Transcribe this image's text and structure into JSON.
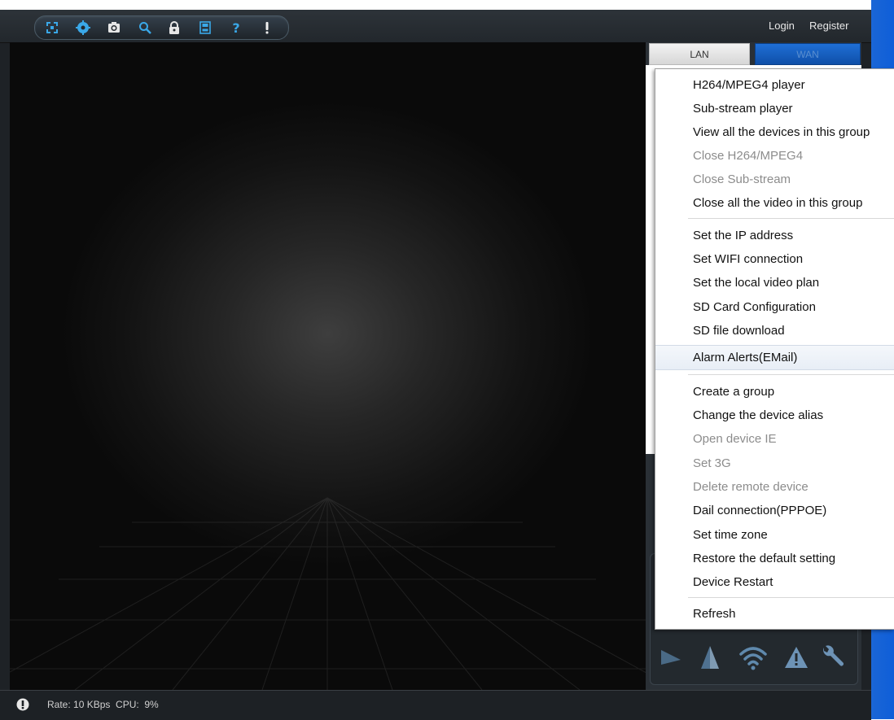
{
  "toolbar": {
    "icons": [
      "multi-screen-icon",
      "settings-icon",
      "camera-icon",
      "search-icon",
      "lock-icon",
      "save-icon",
      "help-icon",
      "info-icon"
    ],
    "login_label": "Login",
    "register_label": "Register",
    "accent_color": "#3aa8e8"
  },
  "panel": {
    "tab_lan": "LAN",
    "tab_wan": "WAN"
  },
  "context_menu": {
    "groups": [
      [
        "H264/MPEG4 player",
        "Sub-stream player",
        "View all the devices in this group",
        "Close H264/MPEG4",
        "Close Sub-stream",
        "Close all the video in this group"
      ],
      [
        "Set the IP address",
        "Set WIFI connection",
        "Set the local video plan",
        "SD Card Configuration",
        "SD file download",
        "Alarm Alerts(EMail)"
      ],
      [
        "Create a group",
        "Change the device alias",
        "Open device IE",
        "Set 3G",
        "Delete remote device",
        "Dail connection(PPPOE)",
        "Set time zone",
        "Restore the default setting",
        "Device Restart"
      ],
      [
        "Refresh"
      ]
    ],
    "disabled_items": [
      "Close H264/MPEG4",
      "Close Sub-stream",
      "Open device IE",
      "Set 3G",
      "Delete remote device"
    ],
    "highlighted_item": "Alarm Alerts(EMail)"
  },
  "status": {
    "text": "Rate: 10 KBps  CPU:  9%"
  },
  "colors": {
    "window_blue": "#1565d8",
    "frame_dark": "#1e2226"
  }
}
